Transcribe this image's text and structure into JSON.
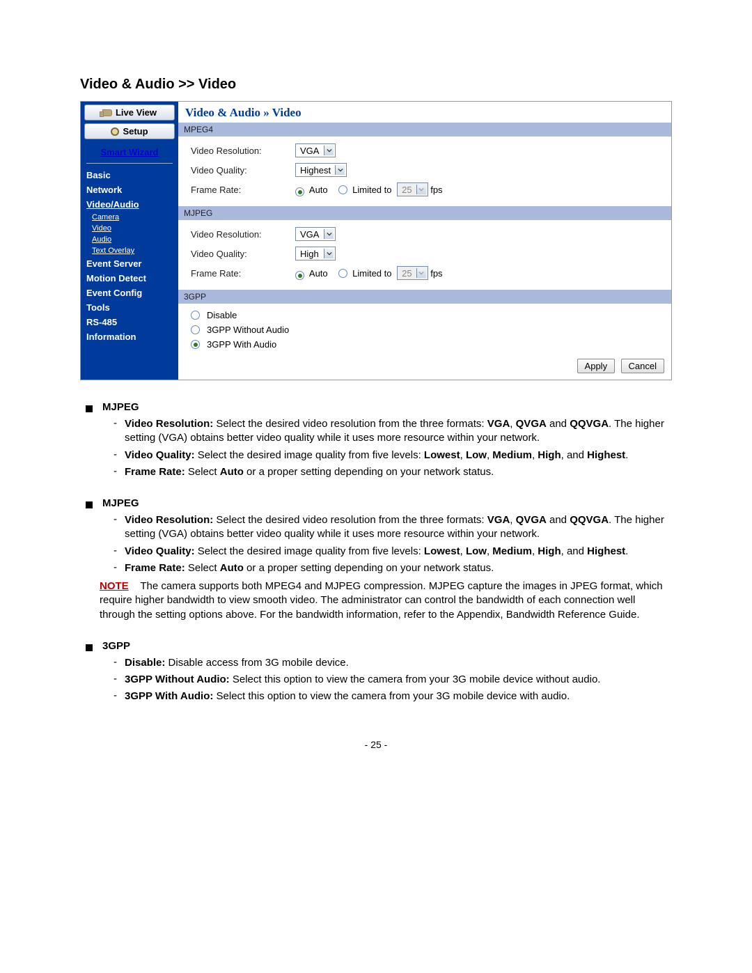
{
  "page_heading": "Video & Audio >> Video",
  "sidebar": {
    "live_view": "Live View",
    "setup": "Setup",
    "smart_wizard": "Smart Wizard",
    "items": [
      "Basic",
      "Network",
      "Video/Audio",
      "Event Server",
      "Motion Detect",
      "Event Config",
      "Tools",
      "RS-485",
      "Information"
    ],
    "sub_items": [
      "Camera",
      "Video",
      "Audio",
      "Text Overlay"
    ]
  },
  "content": {
    "title": "Video & Audio » Video",
    "mpeg4": {
      "header": "MPEG4",
      "res_label": "Video Resolution:",
      "res_value": "VGA",
      "qual_label": "Video Quality:",
      "qual_value": "Highest",
      "fr_label": "Frame Rate:",
      "fr_auto": "Auto",
      "fr_limited": "Limited to",
      "fr_fps_val": "25",
      "fr_fps_unit": "fps"
    },
    "mjpeg": {
      "header": "MJPEG",
      "res_label": "Video Resolution:",
      "res_value": "VGA",
      "qual_label": "Video Quality:",
      "qual_value": "High",
      "fr_label": "Frame Rate:",
      "fr_auto": "Auto",
      "fr_limited": "Limited to",
      "fr_fps_val": "25",
      "fr_fps_unit": "fps"
    },
    "gpp": {
      "header": "3GPP",
      "disable": "Disable",
      "without": "3GPP Without Audio",
      "with": "3GPP With Audio"
    },
    "apply": "Apply",
    "cancel": "Cancel"
  },
  "doc": {
    "mjpeg_head": "MJPEG",
    "vr_label": "Video Resolution: ",
    "vr_text1": "Select the desired video resolution from the three formats: ",
    "vga": "VGA",
    "qvga": "QVGA",
    "and": " and ",
    "qqvga": "QQVGA",
    "vr_text2": ". The higher setting (VGA) obtains better video quality while it uses more resource within your network.",
    "vq_label": "Video Quality: ",
    "vq_text1": "Select the desired image quality from five levels: ",
    "lowest": "Lowest",
    "low": "Low",
    "medium": "Medium",
    "high": "High",
    "highest": "Highest",
    "vq_text2": ".",
    "and_word": ", and ",
    "comma": ", ",
    "fr_label": "Frame Rate: ",
    "fr_text": "Select ",
    "auto": "Auto",
    "fr_text2": " or a proper setting depending on your network status.",
    "note": "NOTE",
    "note_body": "The camera supports both MPEG4 and MJPEG compression. MJPEG capture the images in JPEG format, which require higher bandwidth to view smooth video. The administrator can control the bandwidth of each connection well through the setting options above. For the bandwidth information, refer to the Appendix, Bandwidth Reference Guide.",
    "gpp_head": "3GPP",
    "disable_label": "Disable: ",
    "disable_text": "Disable access from 3G mobile device.",
    "gwo_label": "3GPP Without Audio: ",
    "gwo_text": "Select this option to view the camera from your 3G mobile device without audio.",
    "gw_label": "3GPP With Audio: ",
    "gw_text": "Select this option to view the camera from your 3G mobile device with audio."
  },
  "page_number": "- 25 -"
}
